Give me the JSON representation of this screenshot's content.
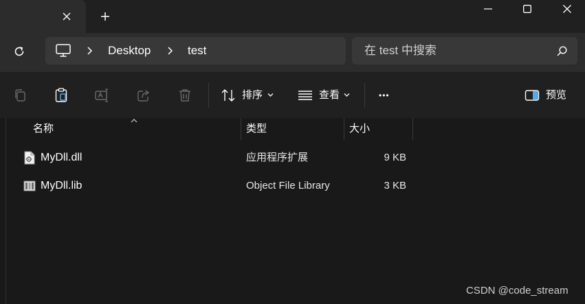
{
  "window": {
    "tab_close_icon": "close-icon",
    "new_tab_icon": "plus-icon",
    "controls": [
      "minimize-icon",
      "maximize-icon",
      "close-icon"
    ]
  },
  "address": {
    "breadcrumbs": [
      "Desktop",
      "test"
    ],
    "root_icon": "this-pc-icon"
  },
  "search": {
    "placeholder": "在 test 中搜索",
    "icon": "search-icon"
  },
  "toolbar": {
    "icons": [
      "copy-icon",
      "paste-icon",
      "rename-icon",
      "share-icon",
      "delete-icon"
    ],
    "sort_label": "排序",
    "view_label": "查看",
    "more_label": "•••",
    "preview_label": "预览"
  },
  "columns": {
    "name": "名称",
    "type": "类型",
    "size": "大小"
  },
  "files": [
    {
      "name": "MyDll.dll",
      "type": "应用程序扩展",
      "size": "9 KB",
      "icon": "dll-file-icon"
    },
    {
      "name": "MyDll.lib",
      "type": "Object File Library",
      "size": "3 KB",
      "icon": "lib-file-icon"
    }
  ],
  "watermark": "CSDN @code_stream",
  "colors": {
    "background": "#191919",
    "titlebar": "#202020",
    "tab": "#2c2c2c",
    "field": "#383838",
    "text": "#ffffff"
  }
}
